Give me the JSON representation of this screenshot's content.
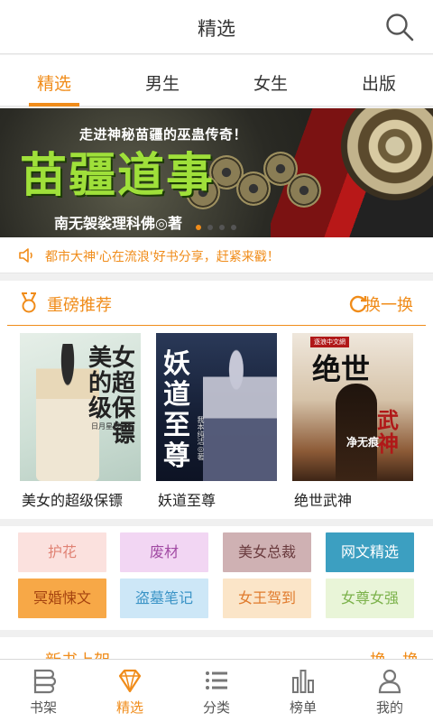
{
  "header": {
    "title": "精选",
    "search_icon": "search-icon"
  },
  "tabs": [
    {
      "label": "精选",
      "active": true
    },
    {
      "label": "男生",
      "active": false
    },
    {
      "label": "女生",
      "active": false
    },
    {
      "label": "出版",
      "active": false
    }
  ],
  "banner": {
    "tagline": "走进神秘苗疆的巫蛊传奇！",
    "title": "苗疆道事",
    "author": "南无袈裟理科佛◎著",
    "slide_count": 4,
    "active_slide": 1
  },
  "notice": {
    "icon": "speaker-icon",
    "text": "都市大神'心在流浪'好书分享，赶紧来戳！"
  },
  "recommend": {
    "title": "重磅推荐",
    "refresh_label": "换一换",
    "books": [
      {
        "name": "美女的超级保镖",
        "cover_title": "美女的超级保镖",
        "cover_sub": "日月星辰◎著"
      },
      {
        "name": "妖道至尊",
        "cover_title": "妖道至尊",
        "cover_sub": "我本纯洁◎著"
      },
      {
        "name": "绝世武神",
        "cover_title": "绝世",
        "cover_title2": "武神",
        "cover_tag": "逐浪中文網",
        "cover_author": "净无痕"
      }
    ]
  },
  "categories": [
    {
      "label": "护花",
      "bg": "#fbe1de",
      "color": "#e08274"
    },
    {
      "label": "废材",
      "bg": "#f2d6f3",
      "color": "#a24ba4"
    },
    {
      "label": "美女总裁",
      "bg": "#cfb1b3",
      "color": "#6a3b3e"
    },
    {
      "label": "网文精选",
      "bg": "#3c9fc1",
      "color": "#ffffff"
    },
    {
      "label": "冥婚悚文",
      "bg": "#f7a847",
      "color": "#a64410"
    },
    {
      "label": "盗墓笔记",
      "bg": "#cde7f7",
      "color": "#3a93c6"
    },
    {
      "label": "女王驾到",
      "bg": "#fbe5c8",
      "color": "#e07a2c"
    },
    {
      "label": "女尊女强",
      "bg": "#e9f5d8",
      "color": "#7cb24b"
    }
  ],
  "next_section": {
    "title": "新书上架",
    "refresh_label": "换一换"
  },
  "tabbar": [
    {
      "label": "书架",
      "icon": "bookshelf-icon",
      "active": false
    },
    {
      "label": "精选",
      "icon": "diamond-icon",
      "active": true
    },
    {
      "label": "分类",
      "icon": "list-icon",
      "active": false
    },
    {
      "label": "榜单",
      "icon": "ranking-bars-icon",
      "active": false
    },
    {
      "label": "我的",
      "icon": "profile-icon",
      "active": false
    }
  ],
  "colors": {
    "accent": "#f08c1a",
    "text": "#333333",
    "bg": "#f0f0f0"
  }
}
